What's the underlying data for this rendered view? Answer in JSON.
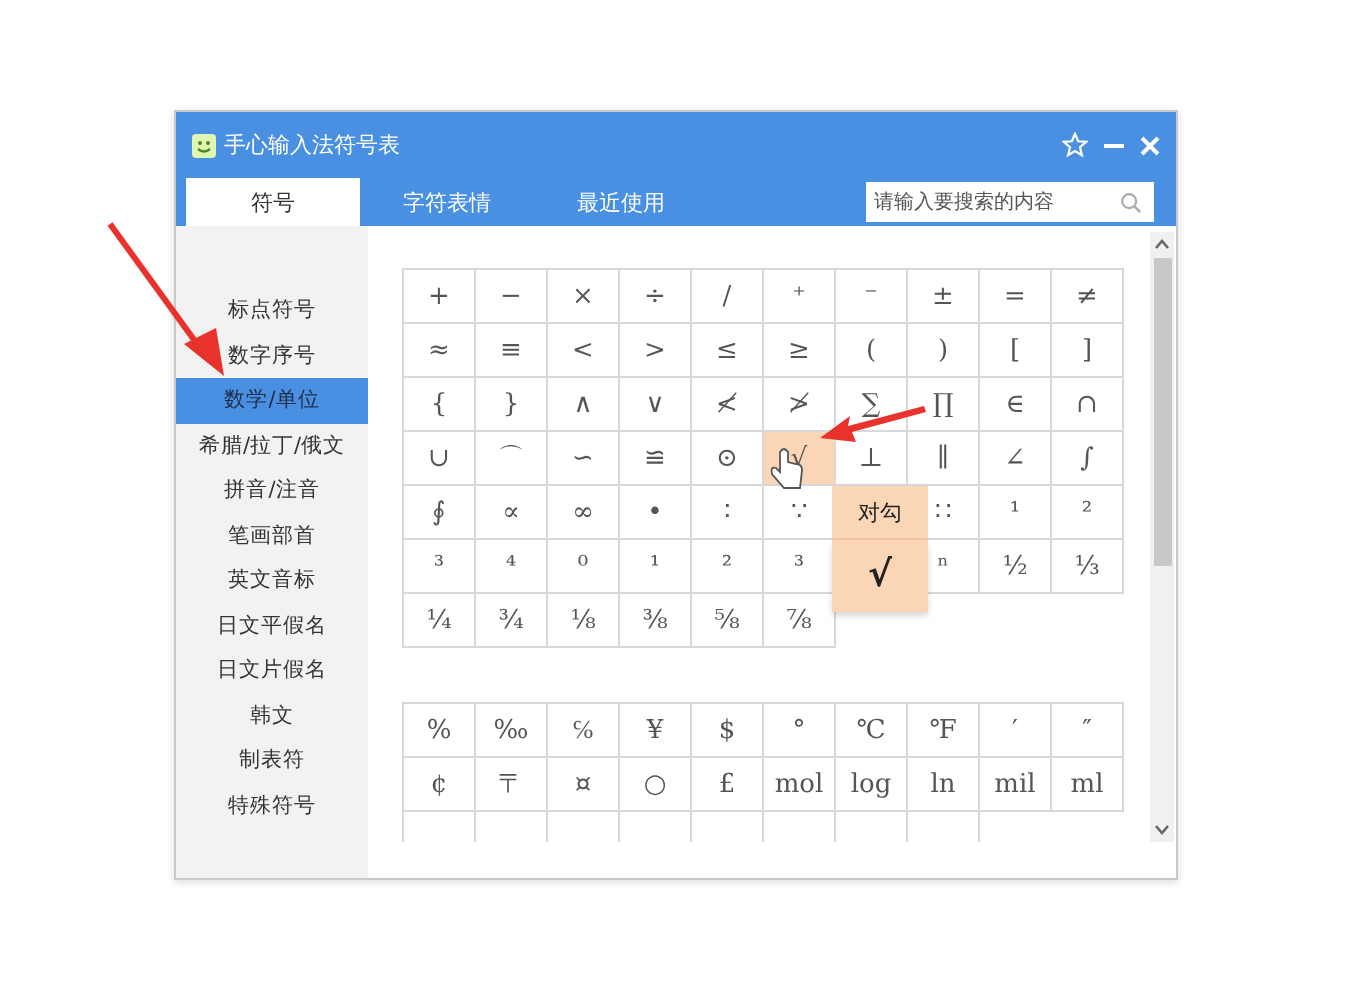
{
  "window": {
    "title": "手心输入法符号表"
  },
  "tabs": [
    {
      "label": "符号",
      "selected": true
    },
    {
      "label": "字符表情",
      "selected": false
    },
    {
      "label": "最近使用",
      "selected": false
    }
  ],
  "search": {
    "placeholder": "请输入要搜索的内容"
  },
  "sidebar": {
    "items": [
      {
        "label": "标点符号",
        "selected": false
      },
      {
        "label": "数字序号",
        "selected": false
      },
      {
        "label": "数学/单位",
        "selected": true
      },
      {
        "label": "希腊/拉丁/俄文",
        "selected": false
      },
      {
        "label": "拼音/注音",
        "selected": false
      },
      {
        "label": "笔画部首",
        "selected": false
      },
      {
        "label": "英文音标",
        "selected": false
      },
      {
        "label": "日文平假名",
        "selected": false
      },
      {
        "label": "日文片假名",
        "selected": false
      },
      {
        "label": "韩文",
        "selected": false
      },
      {
        "label": "制表符",
        "selected": false
      },
      {
        "label": "特殊符号",
        "selected": false
      }
    ]
  },
  "symbol_grids": [
    {
      "rows": [
        [
          {
            "symbol": "+",
            "selected": false
          },
          {
            "symbol": "−",
            "selected": false
          },
          {
            "symbol": "×",
            "selected": false
          },
          {
            "symbol": "÷",
            "selected": false
          },
          {
            "symbol": "/",
            "selected": false
          },
          {
            "symbol": "⁺",
            "selected": false
          },
          {
            "symbol": "⁻",
            "selected": false
          },
          {
            "symbol": "±",
            "selected": false
          },
          {
            "symbol": "=",
            "selected": false
          },
          {
            "symbol": "≠",
            "selected": false
          }
        ],
        [
          {
            "symbol": "≈",
            "selected": false
          },
          {
            "symbol": "≡",
            "selected": false
          },
          {
            "symbol": "<",
            "selected": false
          },
          {
            "symbol": ">",
            "selected": false
          },
          {
            "symbol": "≤",
            "selected": false
          },
          {
            "symbol": "≥",
            "selected": false
          },
          {
            "symbol": "(",
            "selected": false
          },
          {
            "symbol": ")",
            "selected": false
          },
          {
            "symbol": "[",
            "selected": false
          },
          {
            "symbol": "]",
            "selected": false
          }
        ],
        [
          {
            "symbol": "{",
            "selected": false
          },
          {
            "symbol": "}",
            "selected": false
          },
          {
            "symbol": "∧",
            "selected": false
          },
          {
            "symbol": "∨",
            "selected": false
          },
          {
            "symbol": "≮",
            "selected": false
          },
          {
            "symbol": "≯",
            "selected": false
          },
          {
            "symbol": "∑",
            "selected": false
          },
          {
            "symbol": "∏",
            "selected": false
          },
          {
            "symbol": "∈",
            "selected": false
          },
          {
            "symbol": "∩",
            "selected": false
          }
        ],
        [
          {
            "symbol": "∪",
            "selected": false
          },
          {
            "symbol": "⌒",
            "selected": false
          },
          {
            "symbol": "∽",
            "selected": false
          },
          {
            "symbol": "≌",
            "selected": false
          },
          {
            "symbol": "⊙",
            "selected": false
          },
          {
            "symbol": "√",
            "selected": true
          },
          {
            "symbol": "⊥",
            "selected": false
          },
          {
            "symbol": "∥",
            "selected": false
          },
          {
            "symbol": "∠",
            "selected": false
          },
          {
            "symbol": "∫",
            "selected": false
          }
        ],
        [
          {
            "symbol": "∮",
            "selected": false
          },
          {
            "symbol": "∝",
            "selected": false
          },
          {
            "symbol": "∞",
            "selected": false
          },
          {
            "symbol": "•",
            "selected": false
          },
          {
            "symbol": "∶",
            "selected": false
          },
          {
            "symbol": "∵",
            "selected": false
          },
          {
            "kind": "tooltip-label",
            "label": "对勾"
          },
          {
            "symbol": "∷",
            "selected": false
          },
          {
            "symbol": "¹",
            "selected": false
          },
          {
            "symbol": "²",
            "selected": false
          }
        ],
        [
          {
            "symbol": "³",
            "selected": false
          },
          {
            "symbol": "⁴",
            "selected": false
          },
          {
            "symbol": "⁰",
            "selected": false
          },
          {
            "symbol": "¹",
            "selected": false
          },
          {
            "symbol": "²",
            "selected": false
          },
          {
            "symbol": "³",
            "selected": false
          },
          {
            "kind": "tooltip-symbol",
            "symbol": "√"
          },
          {
            "symbol": "ⁿ",
            "selected": false
          },
          {
            "symbol": "½",
            "selected": false
          },
          {
            "symbol": "⅓",
            "selected": false
          }
        ],
        [
          {
            "symbol": "¼",
            "selected": false
          },
          {
            "symbol": "¾",
            "selected": false
          },
          {
            "symbol": "⅛",
            "selected": false
          },
          {
            "symbol": "⅜",
            "selected": false
          },
          {
            "symbol": "⅝",
            "selected": false
          },
          {
            "symbol": "⅞",
            "selected": false
          }
        ]
      ]
    },
    {
      "rows": [
        [
          {
            "symbol": "%",
            "selected": false
          },
          {
            "symbol": "‰",
            "selected": false
          },
          {
            "symbol": "℅",
            "selected": false
          },
          {
            "symbol": "¥",
            "selected": false
          },
          {
            "symbol": "$",
            "selected": false
          },
          {
            "symbol": "°",
            "selected": false
          },
          {
            "symbol": "℃",
            "selected": false
          },
          {
            "symbol": "℉",
            "selected": false
          },
          {
            "symbol": "′",
            "selected": false
          },
          {
            "symbol": "″",
            "selected": false
          }
        ],
        [
          {
            "symbol": "¢",
            "selected": false
          },
          {
            "symbol": "〒",
            "selected": false
          },
          {
            "symbol": "¤",
            "selected": false
          },
          {
            "symbol": "○",
            "selected": false
          },
          {
            "symbol": "£",
            "selected": false
          },
          {
            "symbol": "mol",
            "selected": false
          },
          {
            "symbol": "log",
            "selected": false
          },
          {
            "symbol": "ln",
            "selected": false
          },
          {
            "symbol": "mil",
            "selected": false
          },
          {
            "symbol": "ml",
            "selected": false
          }
        ],
        [
          {
            "kind": "cut"
          },
          {
            "kind": "cut"
          },
          {
            "kind": "cut"
          },
          {
            "kind": "cut"
          },
          {
            "kind": "cut"
          },
          {
            "kind": "cut"
          },
          {
            "kind": "cut"
          },
          {
            "kind": "cut"
          }
        ]
      ]
    }
  ]
}
